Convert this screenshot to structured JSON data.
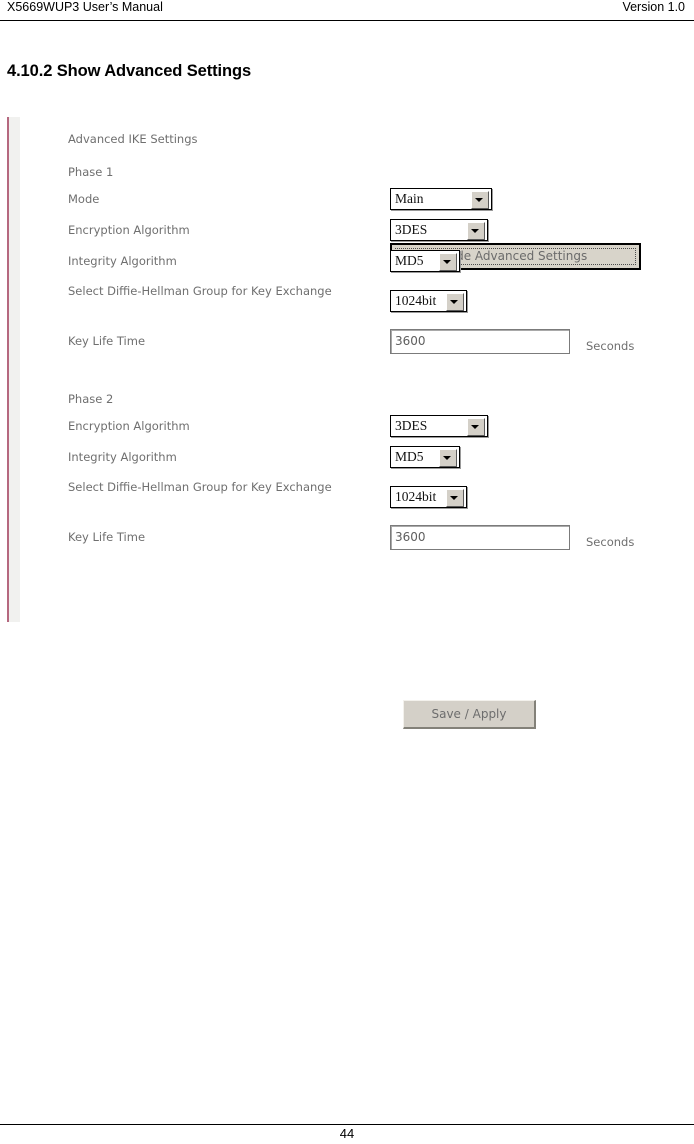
{
  "header": {
    "left_text": "X5669WUP3 User’s Manual",
    "right_text": "Version 1.0"
  },
  "section": {
    "heading": "4.10.2 Show Advanced Settings"
  },
  "screenshot": {
    "title": "Advanced IKE Settings",
    "toggle_button": "Hide Advanced Settings",
    "submit_button": "Save / Apply",
    "unit_label": "Seconds",
    "accent_bar_color": "#b5687f",
    "panel_strip_color": "#f1f1ef",
    "phase1": {
      "heading": "Phase 1",
      "rows": [
        {
          "label": "Mode",
          "value": "Main",
          "control": "select"
        },
        {
          "label": "Encryption Algorithm",
          "value": "3DES",
          "control": "select"
        },
        {
          "label": "Integrity Algorithm",
          "value": "MD5",
          "control": "select"
        },
        {
          "label": "Select Diffie-Hellman Group for Key Exchange",
          "value": "1024bit",
          "control": "select"
        },
        {
          "label": "Key Life Time",
          "value": "3600",
          "control": "text",
          "unit": "Seconds"
        }
      ]
    },
    "phase2": {
      "heading": "Phase 2",
      "rows": [
        {
          "label": "Encryption Algorithm",
          "value": "3DES",
          "control": "select"
        },
        {
          "label": "Integrity Algorithm",
          "value": "MD5",
          "control": "select"
        },
        {
          "label": "Select Diffie-Hellman Group for Key Exchange",
          "value": "1024bit",
          "control": "select"
        },
        {
          "label": "Key Life Time",
          "value": "3600",
          "control": "text",
          "unit": "Seconds"
        }
      ]
    }
  },
  "footer": {
    "page_number": "44"
  }
}
